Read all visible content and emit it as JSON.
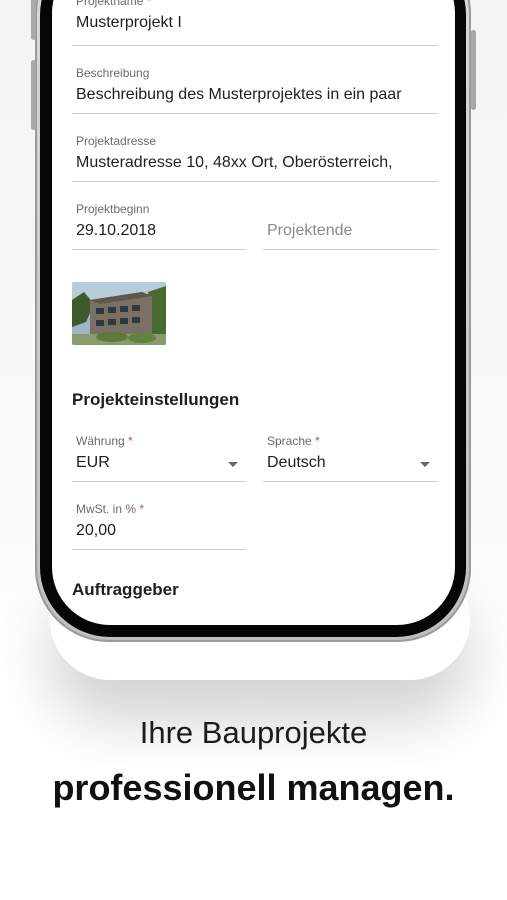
{
  "form": {
    "projektname": {
      "label": "Projektname",
      "required_mark": "*",
      "value": "Musterprojekt I"
    },
    "beschreibung": {
      "label": "Beschreibung",
      "value": "Beschreibung des Musterprojektes in ein paar"
    },
    "projektadresse": {
      "label": "Projektadresse",
      "value": "Musteradresse 10, 48xx Ort, Oberösterreich,"
    },
    "projektbeginn": {
      "label": "Projektbeginn",
      "value": "29.10.2018"
    },
    "projektende": {
      "placeholder": "Projektende"
    }
  },
  "image": {
    "name": "project-photo"
  },
  "settings": {
    "title": "Projekteinstellungen",
    "waehrung": {
      "label": "Währung",
      "required_mark": "*",
      "value": "EUR"
    },
    "sprache": {
      "label": "Sprache",
      "required_mark": "*",
      "value": "Deutsch"
    },
    "mwst": {
      "label": "MwSt. in %",
      "required_mark": "*",
      "value": "20,00"
    }
  },
  "auftraggeber": {
    "title": "Auftraggeber"
  },
  "marketing": {
    "line1": "Ihre Bauprojekte",
    "line2": "professionell managen."
  },
  "colors": {
    "required": "#d04a4a",
    "underline": "#cfcfcf",
    "phone_bezel": "#050505"
  }
}
